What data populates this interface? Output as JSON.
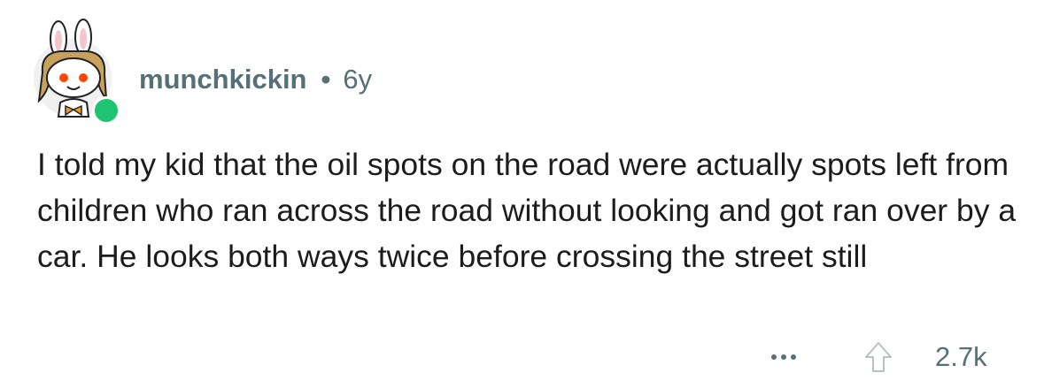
{
  "comment": {
    "username": "munchkickin",
    "separator": "•",
    "age": "6y",
    "body": "I told my kid that the oil spots on the road were actually spots left from children who ran across the road without looking and got ran over by a car. He looks both ways twice before crossing the street still",
    "score": "2.7k",
    "online": true
  },
  "icons": {
    "avatar": "snoo-bunny-avatar",
    "more": "ellipsis-icon",
    "upvote": "upvote-arrow-icon",
    "status": "online-status-dot"
  },
  "colors": {
    "meta_text": "#576f76",
    "body_text": "#1c1c1c",
    "online": "#1fc473",
    "background": "#ffffff"
  }
}
